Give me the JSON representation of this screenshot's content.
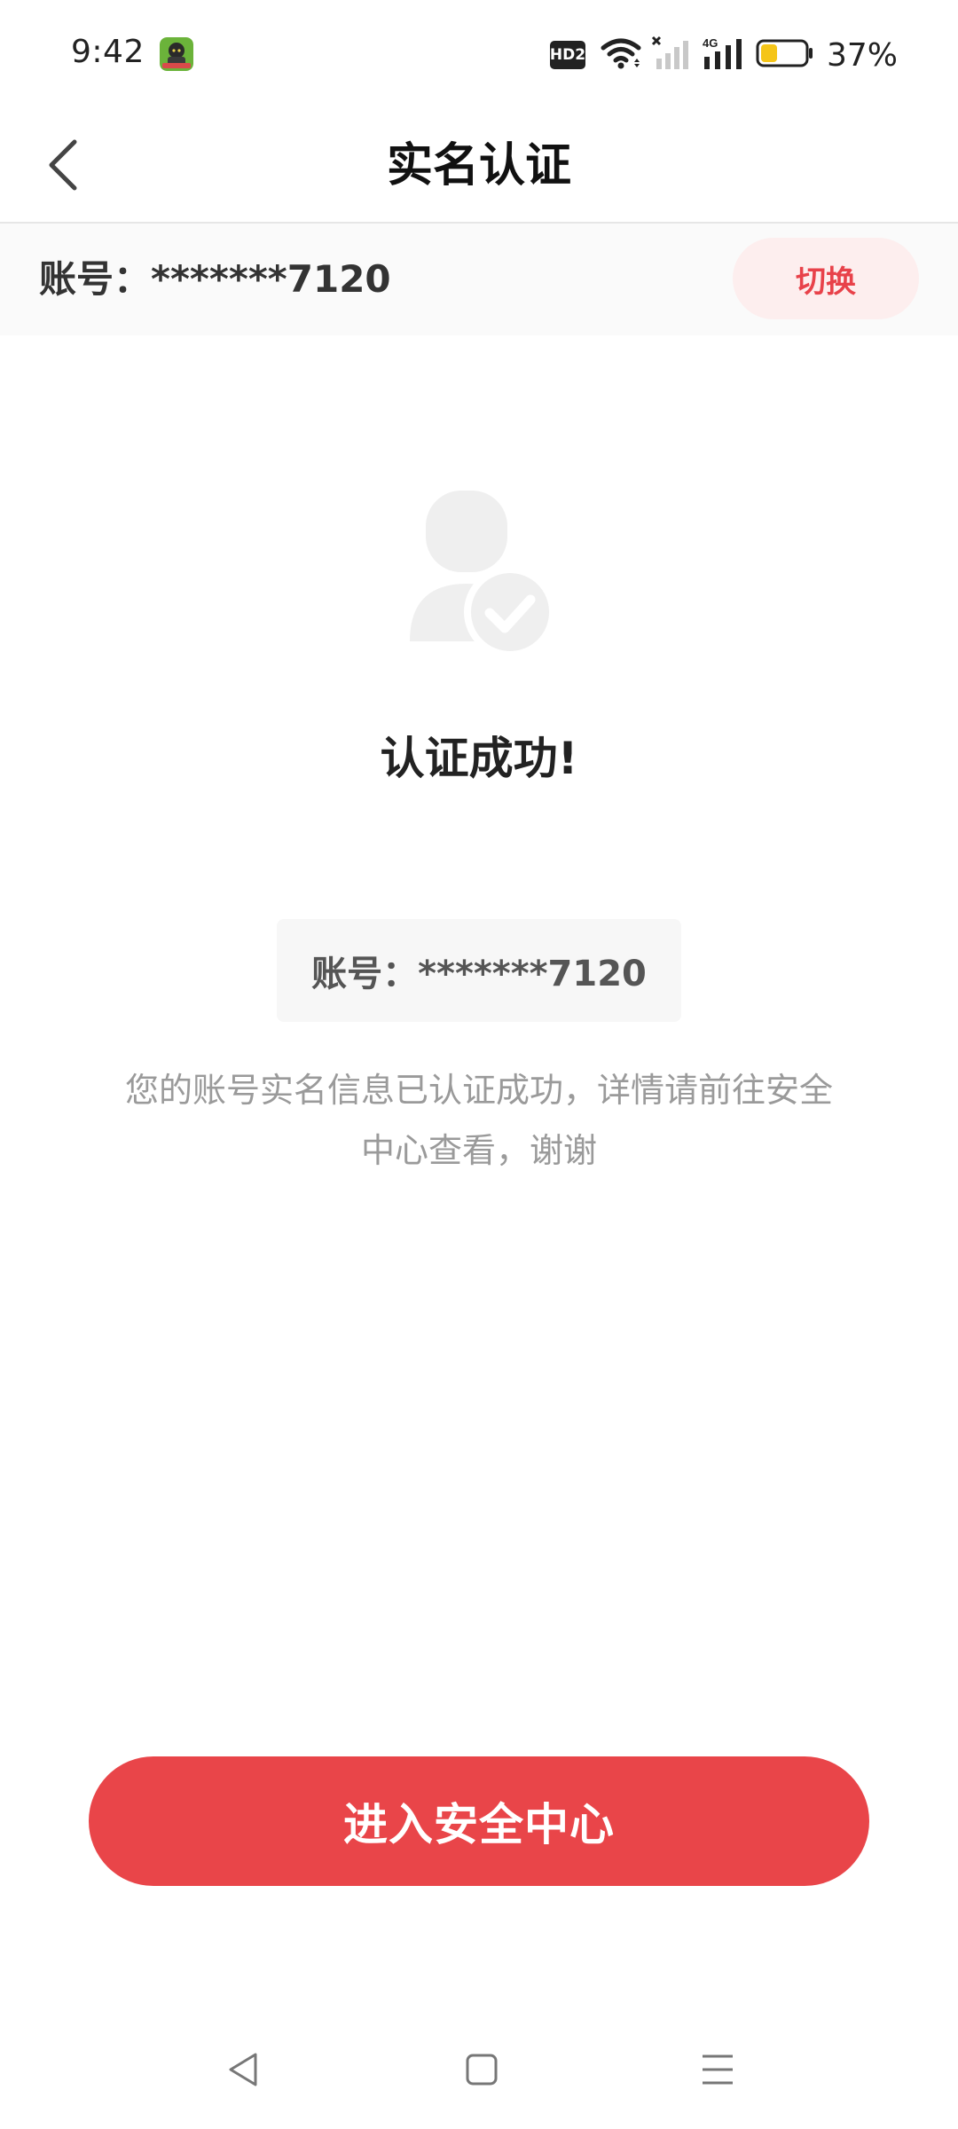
{
  "status_bar": {
    "time": "9:42",
    "hd_badge": "HD2",
    "battery_percent": "37%",
    "battery_level": 0.37,
    "battery_fill_color": "#f5c518",
    "icons": [
      "app-notification-icon",
      "hd-icon",
      "wifi-icon",
      "signal-no-sim-icon",
      "signal-4g-icon",
      "battery-icon"
    ]
  },
  "nav": {
    "title": "实名认证",
    "back_icon": "chevron-left-icon"
  },
  "account_bar": {
    "account_text": "账号：*******7120",
    "switch_label": "切换"
  },
  "success": {
    "icon": "user-verified-icon",
    "title": "认证成功!",
    "account_text": "账号：*******7120",
    "description_line1": "您的账号实名信息已认证成功，详情请前往安全",
    "description_line2": "中心查看，谢谢"
  },
  "cta": {
    "label": "进入安全中心"
  },
  "system_nav": {
    "back": "back-triangle-icon",
    "home": "home-square-icon",
    "menu": "menu-lines-icon"
  },
  "colors": {
    "accent": "#e94549",
    "accent_light": "#fdeeee",
    "text_primary": "#222222",
    "text_secondary": "#9a9a9a"
  }
}
